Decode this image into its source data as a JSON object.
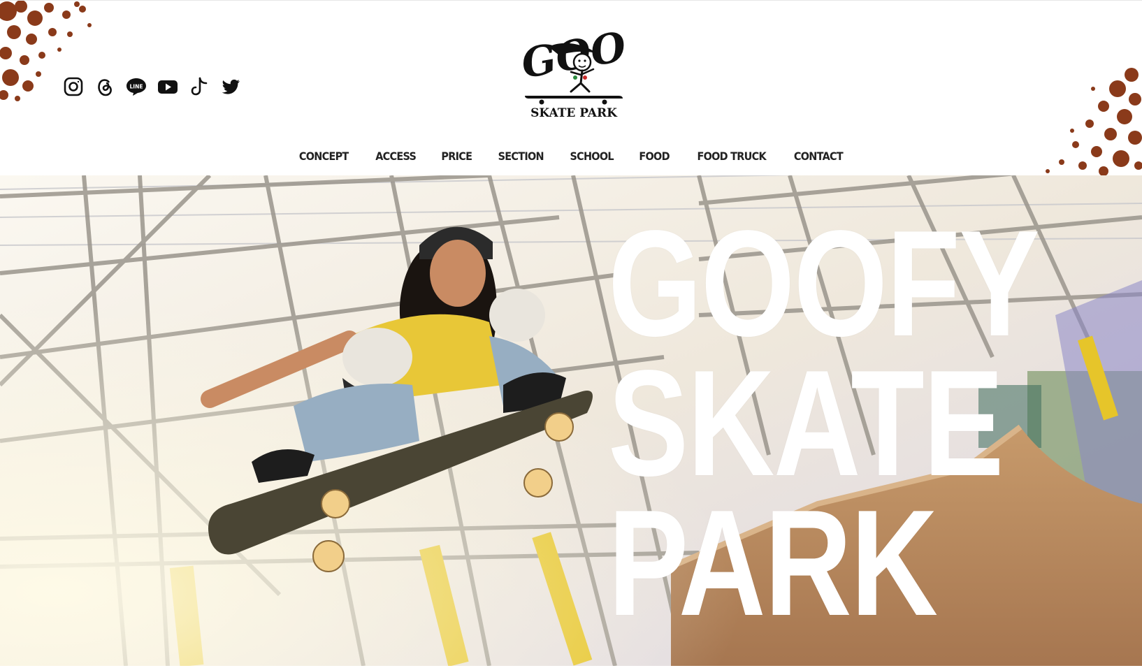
{
  "brand": {
    "logo_wordmark": "GOOFY",
    "logo_subtitle": "SKATE PARK"
  },
  "social": [
    {
      "name": "instagram-icon"
    },
    {
      "name": "threads-icon"
    },
    {
      "name": "line-icon",
      "label": "LINE"
    },
    {
      "name": "youtube-icon"
    },
    {
      "name": "tiktok-icon"
    },
    {
      "name": "twitter-icon"
    }
  ],
  "nav": {
    "items": [
      "CONCEPT",
      "ACCESS",
      "PRICE",
      "SECTION",
      "SCHOOL",
      "FOOD",
      "FOOD TRUCK",
      "CONTACT"
    ]
  },
  "hero": {
    "title_lines": [
      "GOOFY",
      "SKATE",
      "PARK"
    ]
  },
  "colors": {
    "splatter": "#8a3a1a",
    "text_dark": "#222222",
    "hero_text": "#ffffff",
    "ramp_wood": "#b98a5c",
    "pole_yellow": "#e6c52a"
  }
}
